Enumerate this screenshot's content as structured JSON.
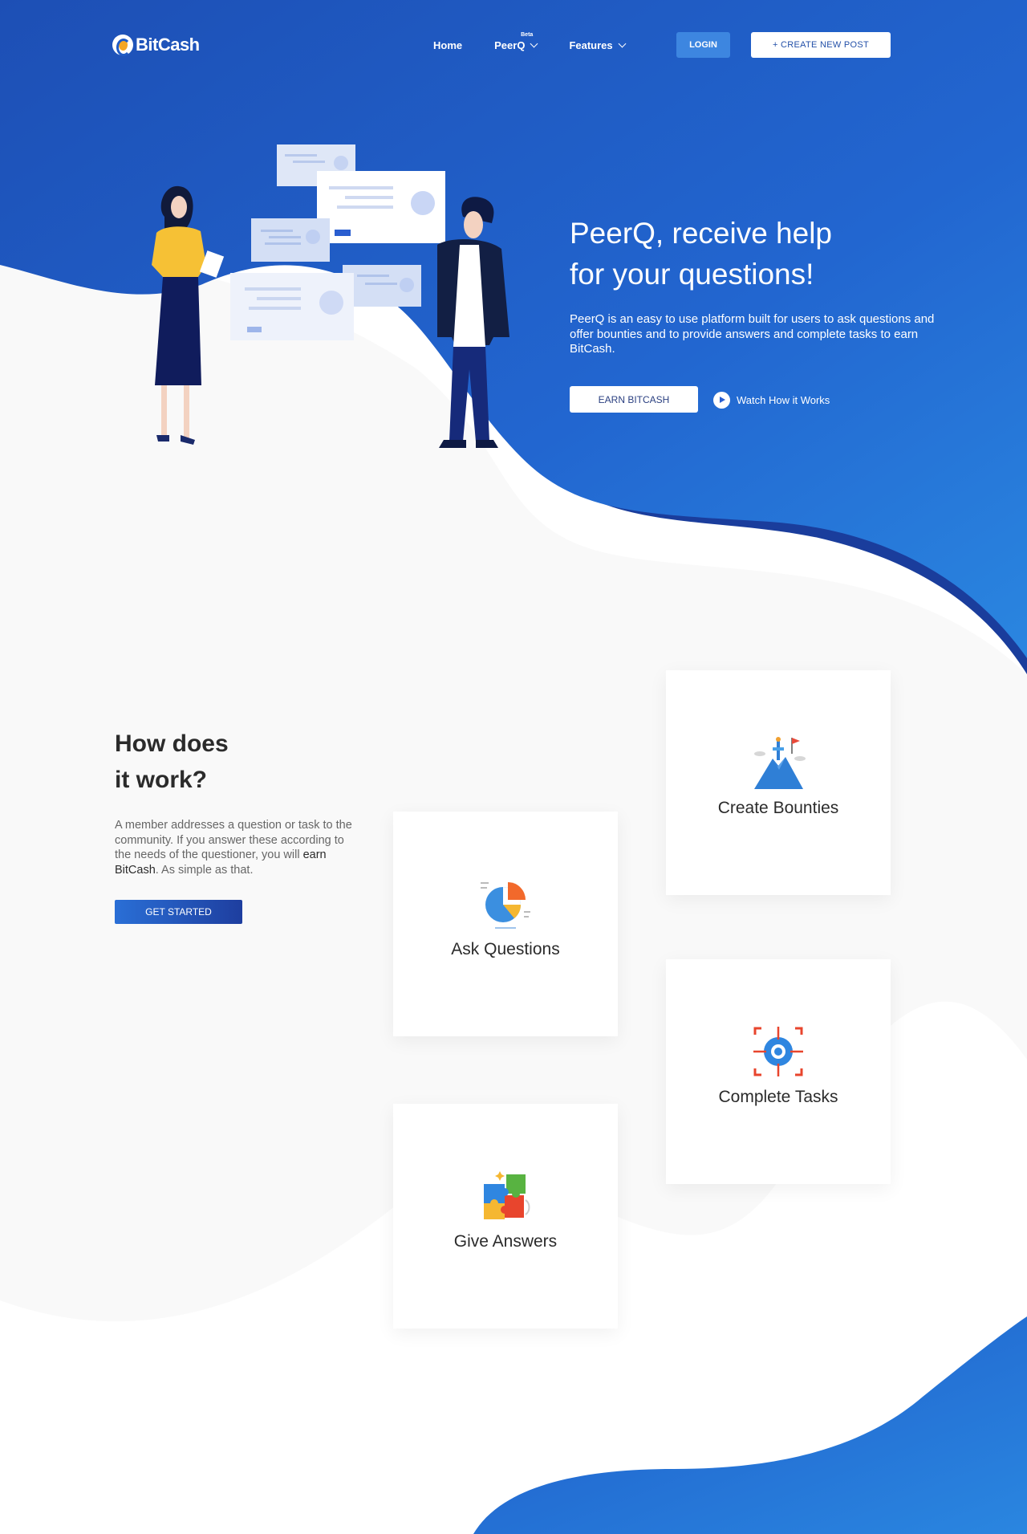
{
  "brand": {
    "name": "BitCash"
  },
  "nav": {
    "items": [
      {
        "label": "Home",
        "has_dropdown": false
      },
      {
        "label": "PeerQ",
        "badge": "Beta",
        "has_dropdown": true
      },
      {
        "label": "Features",
        "has_dropdown": true
      }
    ],
    "login_label": "LOGIN",
    "create_label": "+ CREATE NEW POST"
  },
  "hero": {
    "title_line1": "PeerQ, receive help",
    "title_line2": "for your questions!",
    "description": "PeerQ is an easy to use platform built for users to ask questions and offer bounties and to provide answers and complete tasks to earn BitCash.",
    "earn_button": "EARN BITCASH",
    "watch_label": "Watch How it Works"
  },
  "how": {
    "title_line1": "How does",
    "title_line2": "it work?",
    "desc_before": "A member addresses a question or task to the community. If you answer these according to the needs of the questioner, you will ",
    "desc_strong": "earn BitCash",
    "desc_after": ". As simple as that.",
    "button": "GET STARTED"
  },
  "cards": {
    "create_bounties": {
      "label": "Create Bounties",
      "icon": "mountain-flag-icon"
    },
    "ask_questions": {
      "label": "Ask Questions",
      "icon": "pie-chart-icon"
    },
    "complete_tasks": {
      "label": "Complete Tasks",
      "icon": "target-icon"
    },
    "give_answers": {
      "label": "Give Answers",
      "icon": "puzzle-icon"
    }
  },
  "colors": {
    "primary_blue": "#1f5bc6",
    "light_blue": "#2a86e0",
    "dark_blue": "#1a3d9c",
    "accent_orange": "#f5a623"
  }
}
